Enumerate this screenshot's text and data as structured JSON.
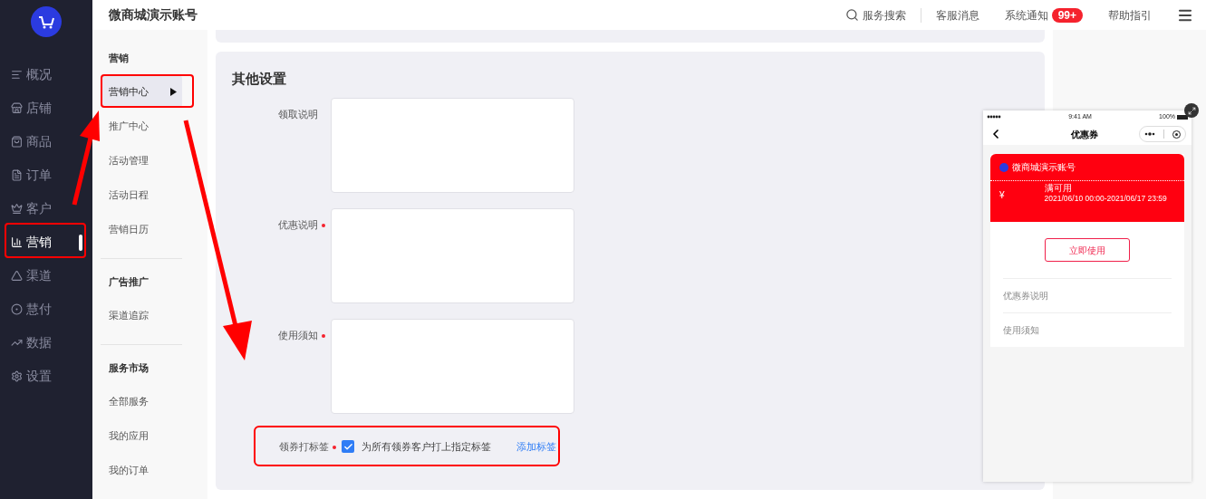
{
  "sidebar": {
    "items": [
      {
        "label": "概况",
        "selected": false
      },
      {
        "label": "店铺",
        "selected": false
      },
      {
        "label": "商品",
        "selected": false
      },
      {
        "label": "订单",
        "selected": false
      },
      {
        "label": "客户",
        "selected": false
      },
      {
        "label": "营销",
        "selected": true
      },
      {
        "label": "渠道",
        "selected": false
      },
      {
        "label": "慧付",
        "selected": false
      },
      {
        "label": "数据",
        "selected": false
      },
      {
        "label": "设置",
        "selected": false
      }
    ]
  },
  "header": {
    "title": "微商城演示账号",
    "actions": [
      {
        "kind": "search",
        "label": "服务搜索"
      },
      {
        "kind": "link",
        "label": "客服消息"
      },
      {
        "kind": "badge",
        "label": "系统通知",
        "badge": "99+"
      },
      {
        "kind": "link",
        "label": "帮助指引"
      }
    ]
  },
  "submenu": {
    "groups": [
      {
        "title": "营销",
        "items": [
          {
            "label": "营销中心",
            "selected": true
          },
          {
            "label": "推广中心",
            "selected": false
          },
          {
            "label": "活动管理",
            "selected": false
          },
          {
            "label": "活动日程",
            "selected": false
          },
          {
            "label": "营销日历",
            "selected": false
          }
        ]
      },
      {
        "title": "广告推广",
        "items": [
          {
            "label": "渠道追踪",
            "selected": false
          }
        ]
      },
      {
        "title": "服务市场",
        "items": [
          {
            "label": "全部服务",
            "selected": false
          },
          {
            "label": "我的应用",
            "selected": false
          },
          {
            "label": "我的订单",
            "selected": false
          }
        ]
      }
    ]
  },
  "form": {
    "title": "其他设置",
    "fields": [
      {
        "label": "领取说明",
        "required": false
      },
      {
        "label": "优惠说明",
        "required": true
      },
      {
        "label": "使用须知",
        "required": true
      }
    ],
    "tag_row": {
      "label": "领券打标签",
      "required": true,
      "checkbox": {
        "label": "为所有领券客户打上指定标签",
        "checked": true
      },
      "link": "添加标签"
    }
  },
  "preview": {
    "time": "9:41 AM",
    "battery": "100%",
    "title": "优惠券",
    "coupon": {
      "shop": "微商城演示账号",
      "condition": "满可用",
      "validity": "2021/06/10 00:00-2021/06/17 23:59",
      "currency": "¥"
    },
    "button": "立即使用",
    "sections": [
      "优惠券说明",
      "使用须知"
    ]
  }
}
